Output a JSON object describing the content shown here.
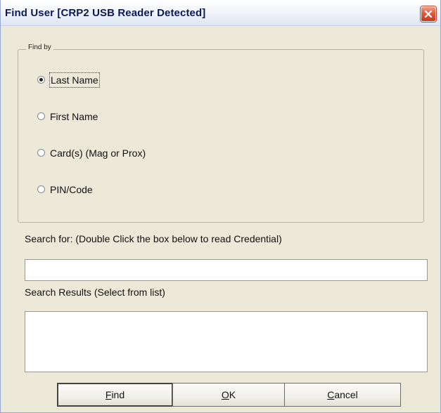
{
  "window": {
    "title": "Find User [CRP2 USB Reader Detected]",
    "close_icon": "close-icon"
  },
  "find_by": {
    "label": "Find by",
    "options": [
      {
        "label": "Last Name",
        "selected": true
      },
      {
        "label": "First Name",
        "selected": false
      },
      {
        "label": "Card(s) (Mag or Prox)",
        "selected": false
      },
      {
        "label": "PIN/Code",
        "selected": false
      }
    ]
  },
  "search": {
    "label": "Search for: (Double Click the box below to read Credential)",
    "value": ""
  },
  "results": {
    "label": "Search Results (Select from list)",
    "items": []
  },
  "buttons": {
    "find": {
      "mnemonic": "F",
      "rest": "ind"
    },
    "ok": {
      "mnemonic": "O",
      "rest": "K"
    },
    "cancel": {
      "mnemonic": "C",
      "rest": "ancel"
    }
  },
  "colors": {
    "dialog_bg": "#ece9d8",
    "title_text": "#0a1a55",
    "close_button": "#e2593a"
  }
}
